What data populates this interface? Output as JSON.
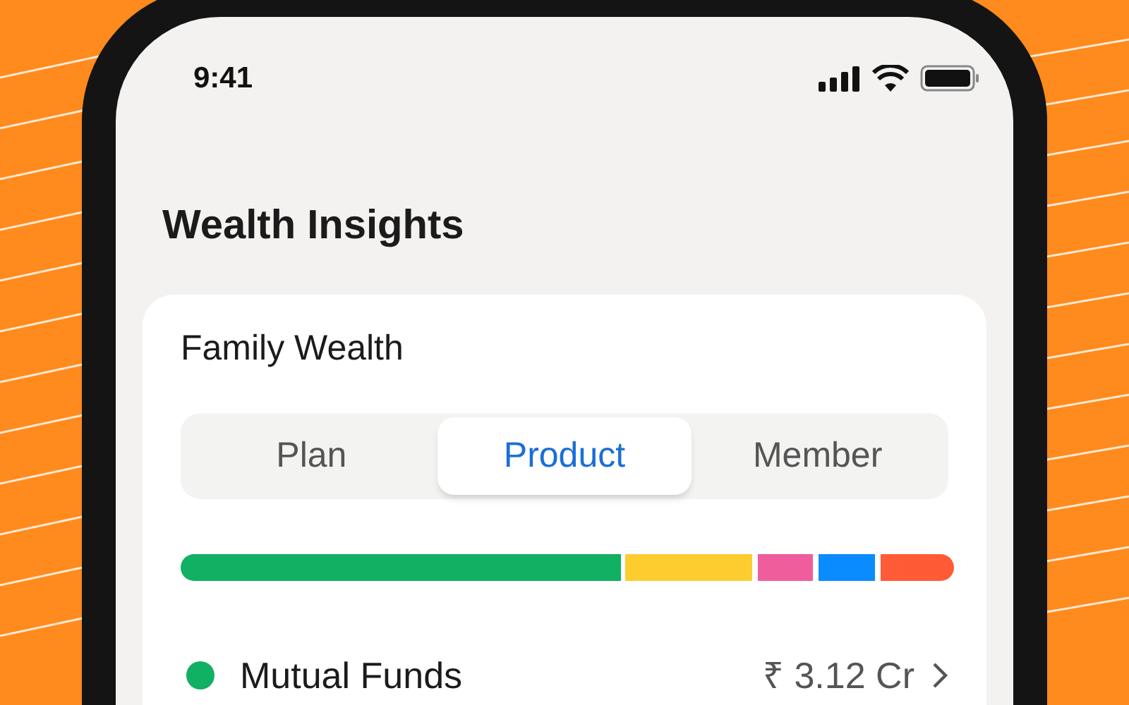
{
  "status_bar": {
    "time": "9:41"
  },
  "title": "Wealth Insights",
  "card": {
    "title": "Family Wealth",
    "tabs": [
      {
        "label": "Plan",
        "selected": false
      },
      {
        "label": "Product",
        "selected": true
      },
      {
        "label": "Member",
        "selected": false
      }
    ],
    "items": [
      {
        "name": "Mutual Funds",
        "value": "₹ 3.12 Cr",
        "color": "#12b062"
      }
    ]
  }
}
